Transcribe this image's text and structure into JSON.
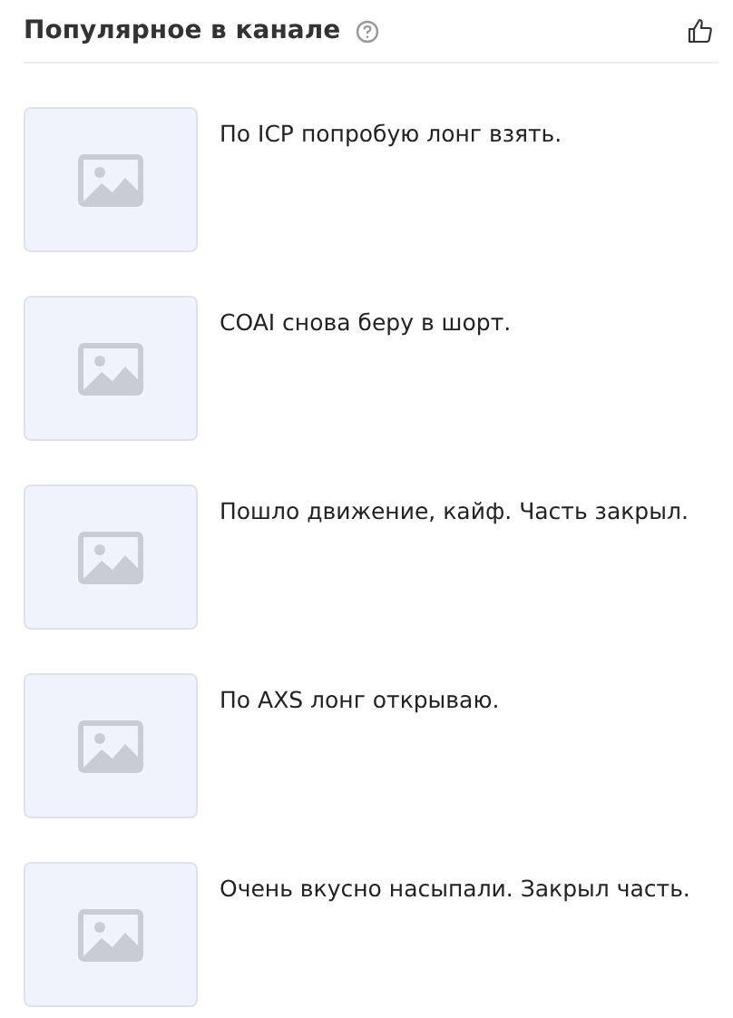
{
  "header": {
    "title": "Популярное в канале"
  },
  "posts": [
    {
      "text": "По ICP попробую лонг взять."
    },
    {
      "text": "COAI снова беру в шорт."
    },
    {
      "text": "Пошло движение, кайф. Часть закрыл."
    },
    {
      "text": "По AXS лонг открываю."
    },
    {
      "text": "Очень вкусно насыпали. Закрыл часть."
    }
  ]
}
